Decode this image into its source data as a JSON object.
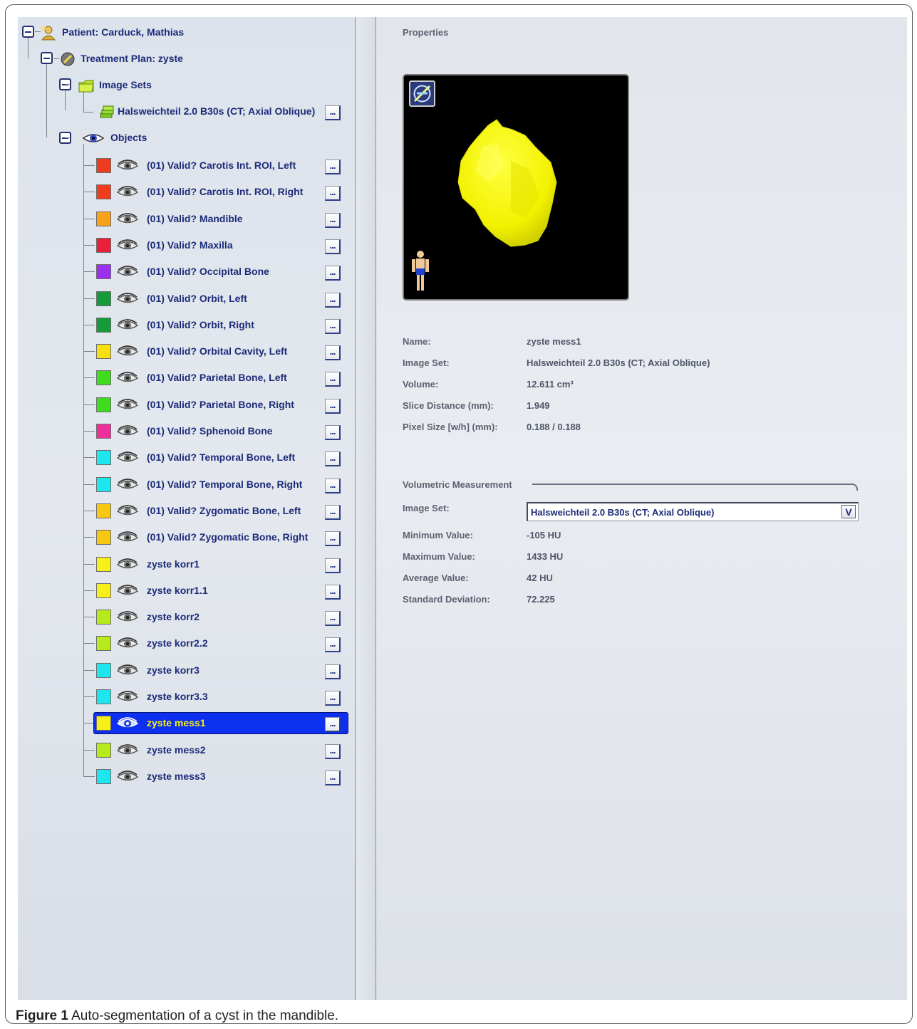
{
  "tree": {
    "patient": {
      "label": "Patient: Carduck, Mathias",
      "icon": "patient-icon"
    },
    "plan": {
      "label": "Treatment Plan: zyste",
      "icon": "treatment-plan-icon"
    },
    "image_sets": {
      "label": "Image Sets",
      "icon": "folder-icon"
    },
    "image_set_item": {
      "label": "Halsweichteil  2.0 B30s (CT; Axial Oblique)",
      "icon": "image-stack-icon",
      "button": "..."
    },
    "objects": {
      "label": "Objects",
      "icon": "eye-icon"
    },
    "object_items": [
      {
        "label": "(01) Valid? Carotis Int. ROI, Left",
        "color": "#f03c1e",
        "button": "..."
      },
      {
        "label": "(01) Valid? Carotis Int. ROI, Right",
        "color": "#f03c1e",
        "button": "..."
      },
      {
        "label": "(01) Valid? Mandible",
        "color": "#f7a21a",
        "button": "..."
      },
      {
        "label": "(01) Valid? Maxilla",
        "color": "#e8203a",
        "button": "..."
      },
      {
        "label": "(01) Valid? Occipital Bone",
        "color": "#9b30ee",
        "button": "..."
      },
      {
        "label": "(01) Valid? Orbit, Left",
        "color": "#169a3a",
        "button": "..."
      },
      {
        "label": "(01) Valid? Orbit, Right",
        "color": "#169a3a",
        "button": "..."
      },
      {
        "label": "(01) Valid? Orbital Cavity, Left",
        "color": "#f7df14",
        "button": "..."
      },
      {
        "label": "(01) Valid? Parietal Bone, Left",
        "color": "#3fdc1e",
        "button": "..."
      },
      {
        "label": "(01) Valid? Parietal Bone, Right",
        "color": "#3fdc1e",
        "button": "..."
      },
      {
        "label": "(01) Valid? Sphenoid Bone",
        "color": "#f0309a",
        "button": "..."
      },
      {
        "label": "(01) Valid? Temporal Bone, Left",
        "color": "#1ee6ee",
        "button": "..."
      },
      {
        "label": "(01) Valid? Temporal Bone, Right",
        "color": "#1ee6ee",
        "button": "..."
      },
      {
        "label": "(01) Valid? Zygomatic Bone, Left",
        "color": "#f7c812",
        "button": "..."
      },
      {
        "label": "(01) Valid? Zygomatic Bone, Right",
        "color": "#f7c812",
        "button": "..."
      },
      {
        "label": "zyste korr1",
        "color": "#f7ef1a",
        "button": "..."
      },
      {
        "label": "zyste korr1.1",
        "color": "#f7ef1a",
        "button": "..."
      },
      {
        "label": "zyste korr2",
        "color": "#b6ea1c",
        "button": "..."
      },
      {
        "label": "zyste korr2.2",
        "color": "#b6ea1c",
        "button": "..."
      },
      {
        "label": "zyste korr3",
        "color": "#1ee6ee",
        "button": "..."
      },
      {
        "label": "zyste korr3.3",
        "color": "#1ee6ee",
        "button": "..."
      },
      {
        "label": "zyste mess1",
        "color": "#f7ef1a",
        "button": "...",
        "selected": true
      },
      {
        "label": "zyste mess2",
        "color": "#b6ea1c",
        "button": "..."
      },
      {
        "label": "zyste mess3",
        "color": "#1ee6ee",
        "button": "..."
      }
    ]
  },
  "properties": {
    "title": "Properties",
    "preview_icons": [
      "compass-orientation-icon",
      "human-figure-icon"
    ],
    "fields": [
      {
        "label": "Name:",
        "value": "zyste mess1"
      },
      {
        "label": "Image Set:",
        "value": "Halsweichteil  2.0 B30s (CT; Axial Oblique)"
      },
      {
        "label": "Volume:",
        "value": "12.611  cm³"
      },
      {
        "label": "Slice Distance (mm):",
        "value": "1.949"
      },
      {
        "label": "Pixel Size [w/h] (mm):",
        "value": "0.188 / 0.188"
      }
    ]
  },
  "volumetric": {
    "title": "Volumetric Measurement",
    "image_set_label": "Image Set:",
    "image_set_value": "Halsweichteil  2.0 B30s (CT; Axial Oblique)",
    "dropdown_arrow": "V",
    "fields": [
      {
        "label": "Minimum Value:",
        "value": "-105  HU"
      },
      {
        "label": "Maximum Value:",
        "value": "1433  HU"
      },
      {
        "label": "Average Value:",
        "value": "42  HU"
      },
      {
        "label": "Standard Deviation:",
        "value": "72.225"
      }
    ]
  },
  "caption": {
    "prefix": "Figure 1",
    "text": " Auto-segmentation of a cyst in the mandible."
  },
  "colors": {
    "tree_text": "#1c2b78",
    "selection": "#0c2ff0",
    "selected_text": "#f7ef1a",
    "cyst": "#ffff00"
  }
}
